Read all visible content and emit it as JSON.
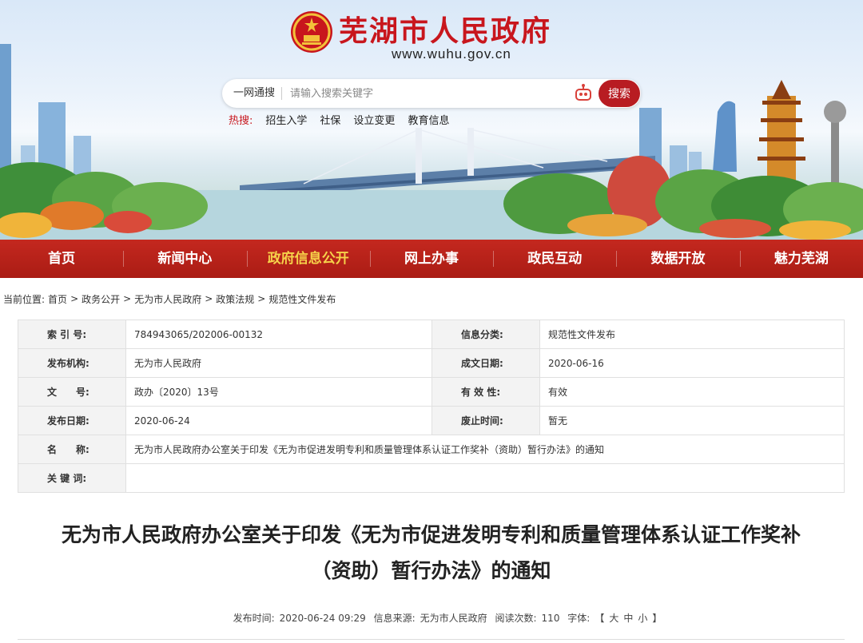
{
  "header": {
    "site_title": "芜湖市人民政府",
    "site_url": "www.wuhu.gov.cn",
    "search": {
      "scope": "一网通搜",
      "placeholder": "请输入搜索关键字",
      "button": "搜索"
    },
    "hot": {
      "label": "热搜:",
      "items": [
        "招生入学",
        "社保",
        "设立变更",
        "教育信息"
      ]
    }
  },
  "nav": {
    "items": [
      "首页",
      "新闻中心",
      "政府信息公开",
      "网上办事",
      "政民互动",
      "数据开放",
      "魅力芜湖"
    ],
    "active_index": 2
  },
  "breadcrumb": {
    "prefix": "当前位置:",
    "items": [
      "首页",
      "政务公开",
      "无为市人民政府",
      "政策法规",
      "规范性文件发布"
    ],
    "separator": ">"
  },
  "meta": {
    "index_no_label": "索 引 号:",
    "index_no": "784943065/202006-00132",
    "category_label": "信息分类:",
    "category": "规范性文件发布",
    "publisher_label": "发布机构:",
    "publisher": "无为市人民政府",
    "written_date_label": "成文日期:",
    "written_date": "2020-06-16",
    "doc_no_label": "文　　号:",
    "doc_no": "政办〔2020〕13号",
    "validity_label": "有 效 性:",
    "validity": "有效",
    "publish_date_label": "发布日期:",
    "publish_date": "2020-06-24",
    "expiry_label": "废止时间:",
    "expiry": "暂无",
    "name_label": "名　　称:",
    "name": "无为市人民政府办公室关于印发《无为市促进发明专利和质量管理体系认证工作奖补（资助）暂行办法》的通知",
    "keywords_label": "关 键 词:",
    "keywords": ""
  },
  "article": {
    "title_line1": "无为市人民政府办公室关于印发《无为市促进发明专利和质量管理体系认证工作奖补",
    "title_line2": "（资助）暂行办法》的通知",
    "published_label": "发布时间:",
    "published": "2020-06-24 09:29",
    "source_label": "信息来源:",
    "source": "无为市人民政府",
    "views_label": "阅读次数:",
    "views": "110",
    "font_label": "字体:",
    "font_open": "【",
    "font_large": "大",
    "font_medium": "中",
    "font_small": "小",
    "font_close": "】"
  },
  "colors": {
    "brand_red": "#c8161d",
    "nav_red": "#b6221a",
    "nav_active": "#f6d24a"
  }
}
